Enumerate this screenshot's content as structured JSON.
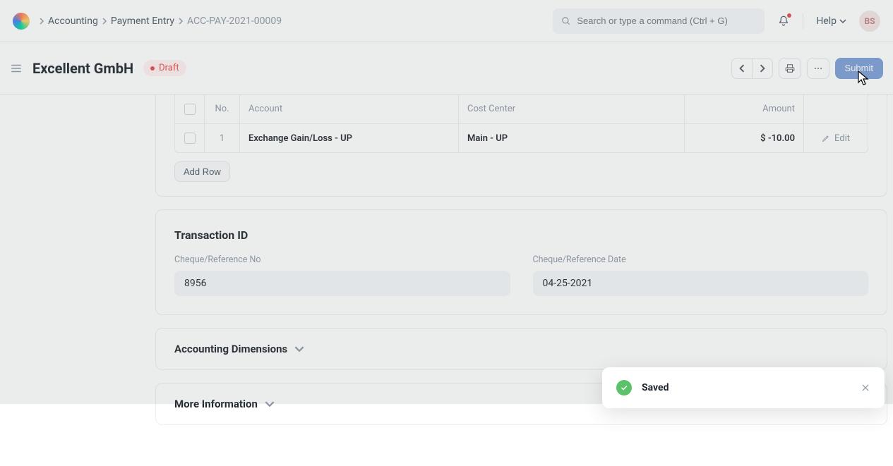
{
  "nav": {
    "crumbs": [
      "Accounting",
      "Payment Entry",
      "ACC-PAY-2021-00009"
    ],
    "search_placeholder": "Search or type a command (Ctrl + G)",
    "help_label": "Help",
    "avatar_initials": "BS"
  },
  "toolbar": {
    "title": "Excellent GmbH",
    "status": "Draft",
    "submit_label": "Submit"
  },
  "table": {
    "head": {
      "no": "No.",
      "account": "Account",
      "cost_center": "Cost Center",
      "amount": "Amount"
    },
    "rows": [
      {
        "no": "1",
        "account": "Exchange Gain/Loss - UP",
        "cost_center": "Main - UP",
        "amount": "$ -10.00",
        "edit": "Edit"
      }
    ],
    "add_row": "Add Row"
  },
  "transaction": {
    "title": "Transaction ID",
    "ref_no_label": "Cheque/Reference No",
    "ref_no_value": "8956",
    "ref_date_label": "Cheque/Reference Date",
    "ref_date_value": "04-25-2021"
  },
  "collapse": {
    "acc_dim": "Accounting Dimensions",
    "more_info": "More Information"
  },
  "toast": {
    "text": "Saved"
  }
}
